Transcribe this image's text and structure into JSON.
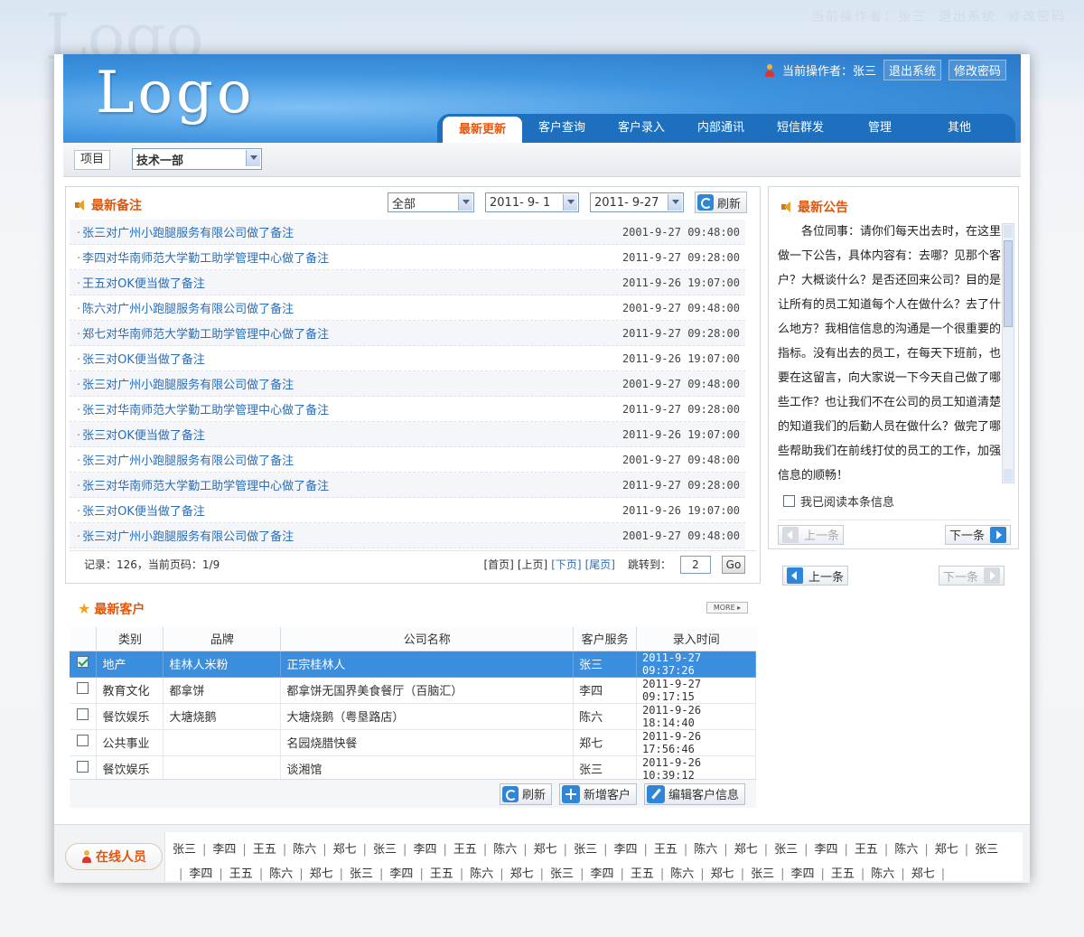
{
  "header": {
    "logo": "Logo",
    "operator_label": "当前操作者：张三",
    "logout": "退出系统",
    "change_password": "修改密码"
  },
  "nav": {
    "items": [
      "最新更新",
      "客户查询",
      "客户录入",
      "内部通讯",
      "短信群发",
      "管理",
      "其他"
    ],
    "active_index": 0
  },
  "subbar": {
    "label": "项目",
    "department": "技术一部"
  },
  "notes": {
    "title": "最新备注",
    "filter": "全部",
    "date_from": "2011- 9- 1",
    "date_to": "2011- 9-27",
    "refresh": "刷新",
    "items": [
      {
        "text": "张三对广州小跑腿服务有限公司做了备注",
        "time": "2001-9-27 09:48:00"
      },
      {
        "text": "李四对华南师范大学勤工助学管理中心做了备注",
        "time": "2011-9-27 09:28:00"
      },
      {
        "text": "王五对OK便当做了备注",
        "time": "2011-9-26 19:07:00"
      },
      {
        "text": "陈六对广州小跑腿服务有限公司做了备注",
        "time": "2001-9-27 09:48:00"
      },
      {
        "text": "郑七对华南师范大学勤工助学管理中心做了备注",
        "time": "2011-9-27 09:28:00"
      },
      {
        "text": "张三对OK便当做了备注",
        "time": "2011-9-26 19:07:00"
      },
      {
        "text": "张三对广州小跑腿服务有限公司做了备注",
        "time": "2001-9-27 09:48:00"
      },
      {
        "text": "张三对华南师范大学勤工助学管理中心做了备注",
        "time": "2011-9-27 09:28:00"
      },
      {
        "text": "张三对OK便当做了备注",
        "time": "2011-9-26 19:07:00"
      },
      {
        "text": "张三对广州小跑腿服务有限公司做了备注",
        "time": "2001-9-27 09:48:00"
      },
      {
        "text": "张三对华南师范大学勤工助学管理中心做了备注",
        "time": "2011-9-27 09:28:00"
      },
      {
        "text": "张三对OK便当做了备注",
        "time": "2011-9-26 19:07:00"
      },
      {
        "text": "张三对广州小跑腿服务有限公司做了备注",
        "time": "2001-9-27 09:48:00"
      }
    ],
    "pager": {
      "summary": "记录：126，当前页码：1/9",
      "first": "[首页]",
      "prev": "[上页]",
      "next": "[下页]",
      "last": "[尾页]",
      "jump_label": "跳转到：",
      "jump_value": "2",
      "go": "Go"
    }
  },
  "announce": {
    "title": "最新公告",
    "body": "各位同事：请你们每天出去时，在这里做一下公告，具体内容有：去哪？见那个客户？大概谈什么？是否还回来公司？目的是让所有的员工知道每个人在做什么？去了什么地方？我相信信息的沟通是一个很重要的指标。没有出去的员工，在每天下班前，也要在这留言，向大家说一下今天自己做了哪些工作？也让我们不在公司的员工知道清楚的知道我们的后勤人员在做什么？做完了哪些帮助我们在前线打仗的员工的工作，加强信息的顺畅！",
    "read_label": "我已阅读本条信息",
    "prev": "上一条",
    "next": "下一条"
  },
  "outer_nav": {
    "prev": "上一条",
    "next": "下一条"
  },
  "customers": {
    "title": "最新客户",
    "more": "MORE",
    "columns": [
      "类别",
      "品牌",
      "公司名称",
      "客户服务",
      "录入时间"
    ],
    "rows": [
      {
        "checked": true,
        "category": "地产",
        "brand": "桂林人米粉",
        "company": "正宗桂林人",
        "service": "张三",
        "time": "2011-9-27 09:37:26"
      },
      {
        "checked": false,
        "category": "教育文化",
        "brand": "都拿饼",
        "company": "都拿饼无国界美食餐厅（百脑汇）",
        "service": "李四",
        "time": "2011-9-27 09:17:15"
      },
      {
        "checked": false,
        "category": "餐饮娱乐",
        "brand": "大塘烧鹅",
        "company": "大塘烧鹅（粤垦路店）",
        "service": "陈六",
        "time": "2011-9-26 18:14:40"
      },
      {
        "checked": false,
        "category": "公共事业",
        "brand": "",
        "company": "名园烧腊快餐",
        "service": "郑七",
        "time": "2011-9-26 17:56:46"
      },
      {
        "checked": false,
        "category": "餐饮娱乐",
        "brand": "",
        "company": "谈湘馆",
        "service": "张三",
        "time": "2011-9-26 10:39:12"
      }
    ],
    "actions": {
      "refresh": "刷新",
      "add": "新增客户",
      "edit": "编辑客户信息"
    }
  },
  "online": {
    "title": "在线人员",
    "line1": [
      "张三",
      "李四",
      "王五",
      "陈六",
      "郑七",
      "张三",
      "李四",
      "王五",
      "陈六",
      "郑七",
      "张三",
      "李四",
      "王五",
      "陈六",
      "郑七",
      "张三",
      "李四",
      "王五",
      "陈六",
      "郑七",
      "张三"
    ],
    "line2": [
      "李四",
      "王五",
      "陈六",
      "郑七",
      "张三",
      "李四",
      "王五",
      "陈六",
      "郑七",
      "张三",
      "李四",
      "王五",
      "陈六",
      "郑七",
      "张三",
      "李四",
      "王五",
      "陈六",
      "郑七"
    ]
  }
}
